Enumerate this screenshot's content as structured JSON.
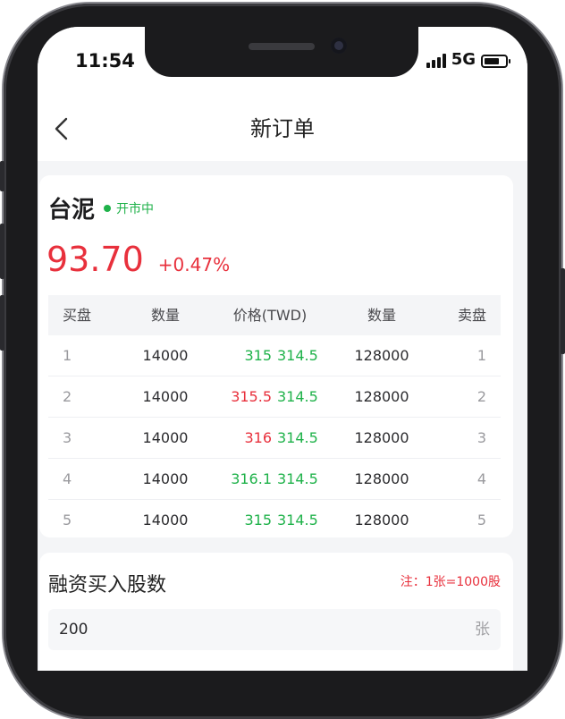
{
  "status_bar": {
    "time": "11:54",
    "network": "5G"
  },
  "header": {
    "title": "新订单"
  },
  "stock": {
    "name": "台泥",
    "market_status": "开市中",
    "price": "93.70",
    "change": "+0.47%"
  },
  "order_book": {
    "headers": {
      "buy": "买盘",
      "qty_buy": "数量",
      "price": "价格(TWD)",
      "qty_sell": "数量",
      "sell": "卖盘"
    },
    "rows": [
      {
        "buy_level": "1",
        "buy_qty": "14000",
        "bid_price": "315",
        "ask_price": "314.5",
        "sell_qty": "128000",
        "sell_level": "1"
      },
      {
        "buy_level": "2",
        "buy_qty": "14000",
        "bid_price": "315.5",
        "ask_price": "314.5",
        "sell_qty": "128000",
        "sell_level": "2"
      },
      {
        "buy_level": "3",
        "buy_qty": "14000",
        "bid_price": "316",
        "ask_price": "314.5",
        "sell_qty": "128000",
        "sell_level": "3"
      },
      {
        "buy_level": "4",
        "buy_qty": "14000",
        "bid_price": "316.1",
        "ask_price": "314.5",
        "sell_qty": "128000",
        "sell_level": "4"
      },
      {
        "buy_level": "5",
        "buy_qty": "14000",
        "bid_price": "315",
        "ask_price": "314.5",
        "sell_qty": "128000",
        "sell_level": "5"
      }
    ]
  },
  "form": {
    "label": "融资买入股数",
    "note": "注：1张=1000股",
    "quantity_value": "200",
    "quantity_unit": "张"
  },
  "colors": {
    "up": "#e8303c",
    "down": "#1fb24a",
    "open_status": "#1fb24a"
  }
}
